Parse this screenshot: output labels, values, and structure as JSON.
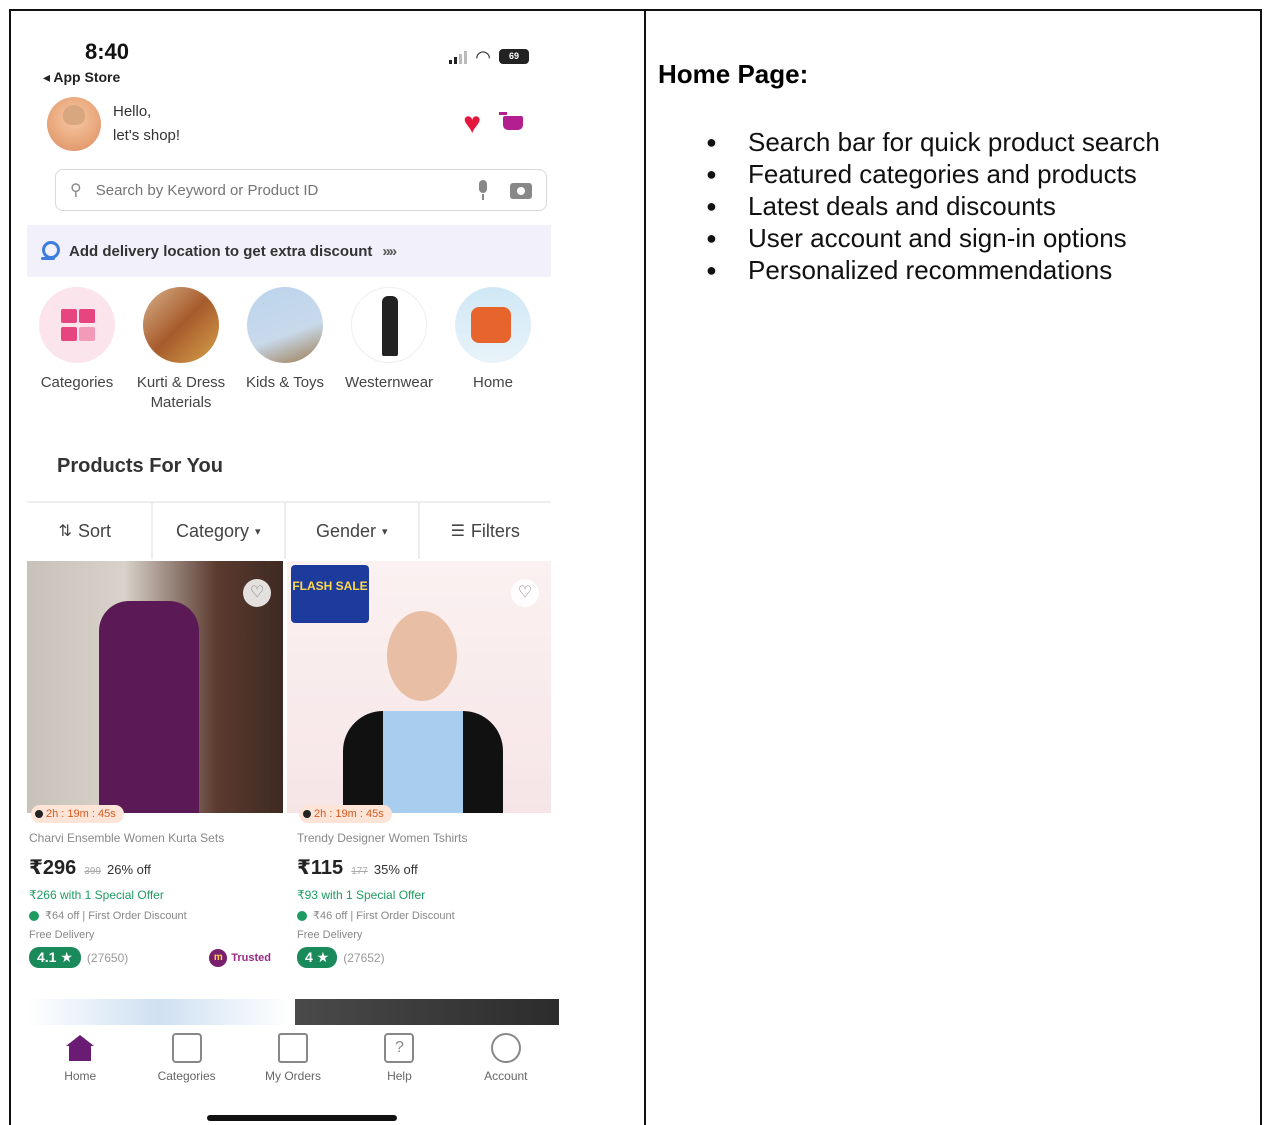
{
  "phone": {
    "status": {
      "time": "8:40",
      "back_label": "◂ App Store",
      "battery": "69"
    },
    "greeting": {
      "line1": "Hello,",
      "line2": "let's shop!"
    },
    "search": {
      "placeholder": "Search by Keyword or Product ID"
    },
    "delivery_banner": {
      "text": "Add delivery location to get extra discount",
      "chevrons": "»»"
    },
    "categories": [
      {
        "label": "Categories"
      },
      {
        "label": "Kurti & Dress Materials"
      },
      {
        "label": "Kids & Toys"
      },
      {
        "label": "Westernwear"
      },
      {
        "label": "Home"
      }
    ],
    "section_title": "Products For You",
    "sort_bar": {
      "sort": "Sort",
      "category": "Category",
      "gender": "Gender",
      "filters": "Filters"
    },
    "products": [
      {
        "timer": "2h : 19m : 45s",
        "name": "Charvi Ensemble Women Kurta Sets",
        "price": "₹296",
        "mrp": "399",
        "discount": "26% off",
        "special_offer": "₹266 with 1 Special Offer",
        "first_order": "₹64 off | First Order Discount",
        "delivery": "Free Delivery",
        "rating": "4.1 ★",
        "rating_count": "(27650)",
        "badge": "Trusted"
      },
      {
        "timer": "2h : 19m : 45s",
        "name": "Trendy Designer Women Tshirts",
        "price": "₹115",
        "mrp": "177",
        "discount": "35% off",
        "special_offer": "₹93 with 1 Special Offer",
        "first_order": "₹46 off | First Order Discount",
        "delivery": "Free Delivery",
        "rating": "4 ★",
        "rating_count": "(27652)",
        "flash_label": "FLASH SALE"
      }
    ],
    "tabs": [
      {
        "label": "Home"
      },
      {
        "label": "Categories"
      },
      {
        "label": "My Orders"
      },
      {
        "label": "Help"
      },
      {
        "label": "Account"
      }
    ]
  },
  "notes": {
    "title": "Home Page:",
    "items": [
      "Search bar for quick product search",
      "Featured categories and products",
      "Latest deals and discounts",
      "User account and sign-in options",
      "Personalized recommendations"
    ]
  },
  "colors": {
    "brand_purple": "#6a1b74",
    "heart_red": "#e5173f",
    "rating_green": "#1b8a5a",
    "offer_green": "#1e9b61"
  }
}
